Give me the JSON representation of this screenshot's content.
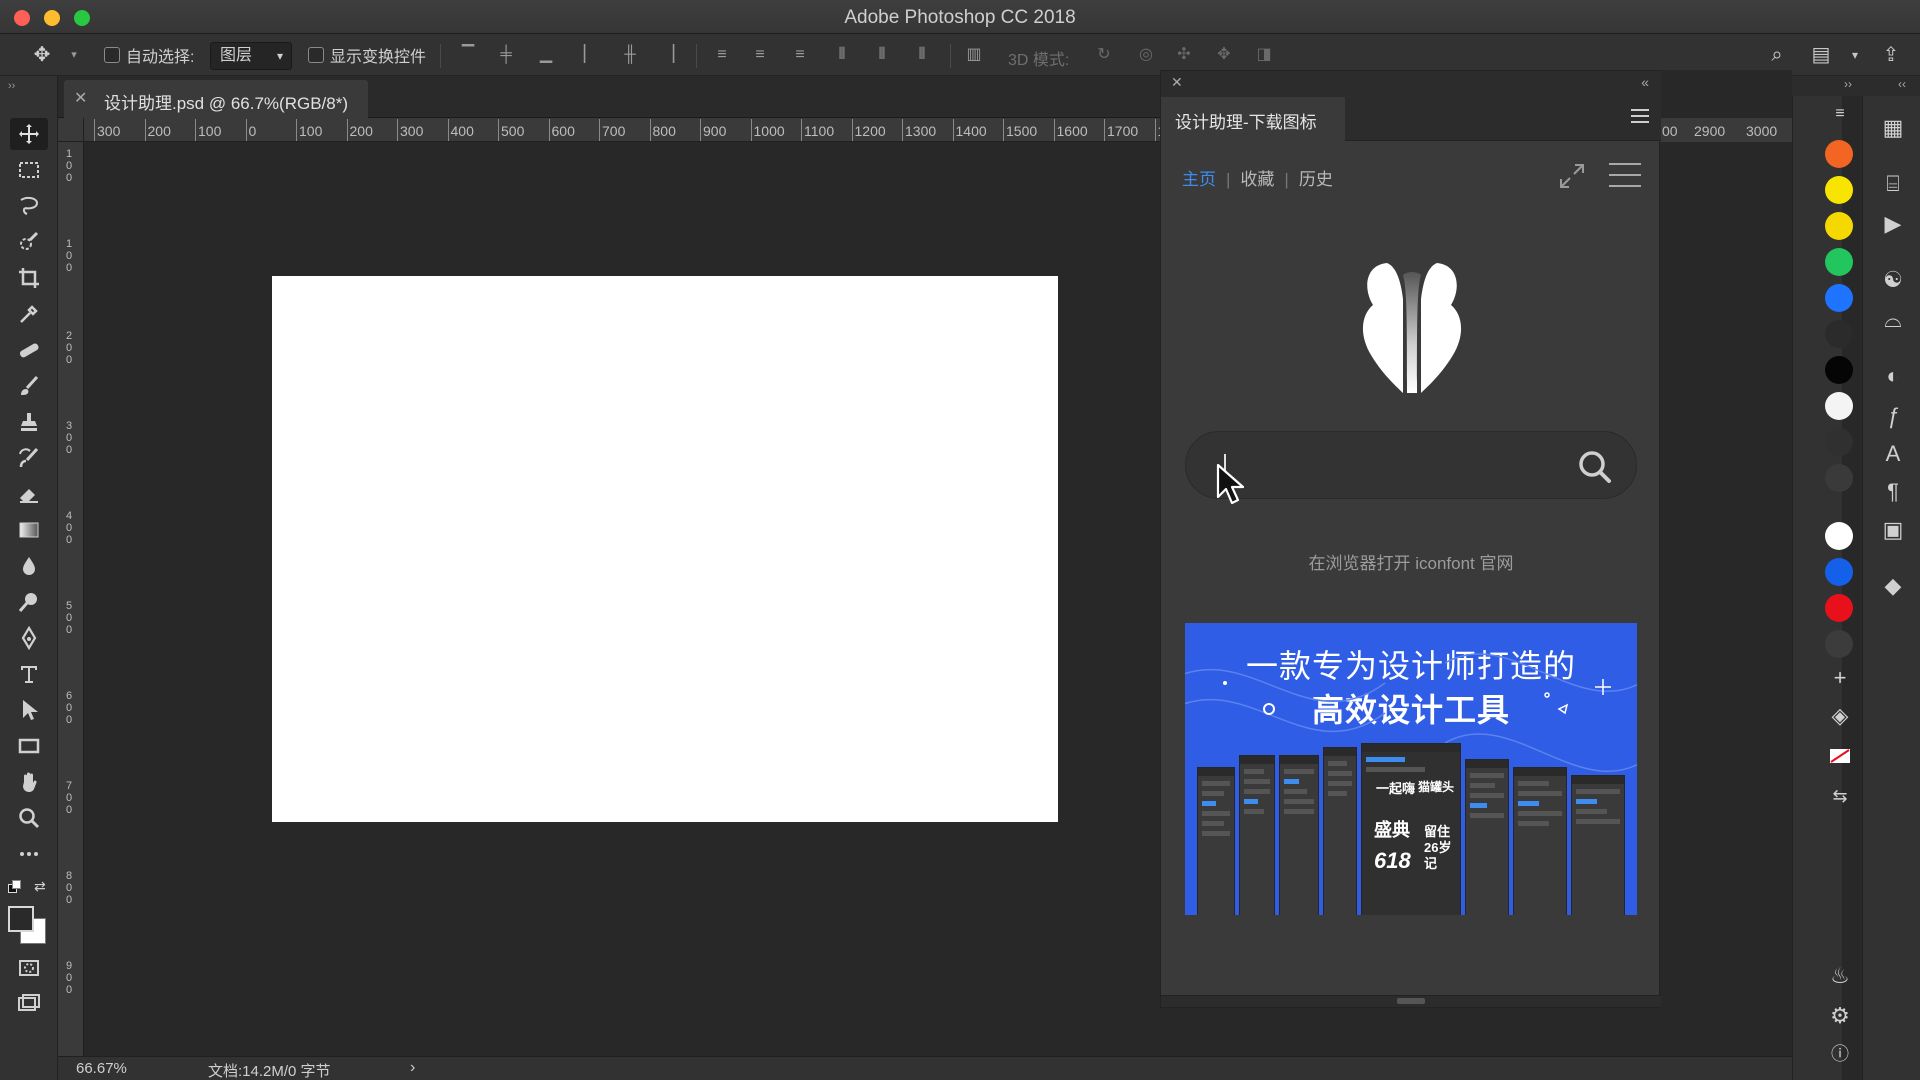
{
  "window": {
    "title": "Adobe Photoshop CC 2018"
  },
  "options_bar": {
    "auto_select_label": "自动选择:",
    "auto_select_value": "图层",
    "transform_controls_label": "显示变换控件",
    "mode_3d_label": "3D 模式:"
  },
  "document": {
    "tab_title": "设计助理.psd @ 66.7%(RGB/8*)",
    "ruler_labels": [
      "300",
      "200",
      "100",
      "0",
      "100",
      "200",
      "300",
      "400",
      "500",
      "600",
      "700",
      "800",
      "900",
      "1000",
      "1100",
      "1200",
      "1300",
      "1400",
      "1500",
      "1600",
      "1700",
      "18"
    ],
    "ruler_labels_right": [
      "00",
      "2900",
      "3000"
    ],
    "canvas_color": "#ffffff"
  },
  "status_bar": {
    "zoom": "66.67%",
    "doc_info": "文档:14.2M/0 字节"
  },
  "plugin": {
    "tab_title": "设计助理-下载图标",
    "nav": {
      "home": "主页",
      "favorites": "收藏",
      "history": "历史"
    },
    "search": {
      "value": "",
      "placeholder": ""
    },
    "open_link": "在浏览器打开 iconfont 官网",
    "banner": {
      "line1": "一款专为设计师打造的",
      "line2": "高效设计工具",
      "background": "#2f5de6",
      "promo_words": [
        "盛典",
        "618",
        "一起嗨",
        "猫罐头",
        "留住26岁记"
      ]
    },
    "accent_color": "#3d8cf0"
  },
  "swatches": [
    "#f26522",
    "#f7e400",
    "#f5d800",
    "#22c55e",
    "#1e73ff",
    "#2b2b2b",
    "#050505",
    "#f4f4f4",
    "#303030",
    "#3a3a3a",
    "#ffffff",
    "#1560e8",
    "#e8101a",
    "#3c3c3c"
  ],
  "tools": [
    "move-tool",
    "marquee-tool",
    "lasso-tool",
    "quick-select-tool",
    "crop-tool",
    "eyedropper-tool",
    "healing-brush-tool",
    "brush-tool",
    "clone-stamp-tool",
    "history-brush-tool",
    "eraser-tool",
    "gradient-tool",
    "blur-tool",
    "dodge-tool",
    "pen-tool",
    "type-tool",
    "path-select-tool",
    "rectangle-tool",
    "hand-tool",
    "zoom-tool",
    "more-tools"
  ]
}
